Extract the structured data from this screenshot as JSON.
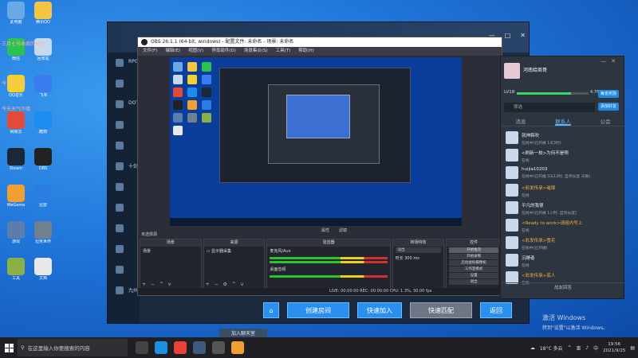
{
  "desktop": {
    "icons": [
      {
        "label": "此电脑",
        "color": "#6aa9e8"
      },
      {
        "label": "腾讯QQ",
        "color": "#f4c542"
      },
      {
        "label": "微信",
        "color": "#2bc24f"
      },
      {
        "label": "回收站",
        "color": "#c5d8ec"
      },
      {
        "label": "QQ音乐",
        "color": "#f5d130"
      },
      {
        "label": "飞书",
        "color": "#3b7bf0"
      },
      {
        "label": "网易云",
        "color": "#e44a3a"
      },
      {
        "label": "酷狗",
        "color": "#1c8cf0"
      },
      {
        "label": "Steam",
        "color": "#1b2838"
      },
      {
        "label": "OBS",
        "color": "#222"
      },
      {
        "label": "WeGame",
        "color": "#f0a030"
      },
      {
        "label": "迅雷",
        "color": "#2a7de1"
      },
      {
        "label": "游戏",
        "color": "#5a7dab"
      },
      {
        "label": "坦克世界",
        "color": "#708090"
      },
      {
        "label": "工具",
        "color": "#8ab04a"
      },
      {
        "label": "文档",
        "color": "#e8e8e8"
      }
    ],
    "red_text": [
      "三月七号本周的研究",
      "今日的心情",
      "今天天气不错"
    ]
  },
  "game": {
    "sidebar": [
      "RPG",
      "",
      "DOTA",
      "",
      "",
      "十剑",
      "",
      "",
      "",
      "",
      "",
      "九州"
    ],
    "buttons": {
      "create": "创建房间",
      "quick_join": "快速加入",
      "quick_match": "快速匹配",
      "back": "返回"
    },
    "join_channel": "加入聊天室"
  },
  "obs": {
    "title": "OBS 26.1.1 (64-bit, windows) - 配置文件: 未命名 - 场景: 未命名",
    "menu": [
      "文件(F)",
      "编辑(E)",
      "视图(V)",
      "停靠部件(D)",
      "场景集合(S)",
      "工具(T)",
      "帮助(H)"
    ],
    "scene_label": "未选择源",
    "status_tabs": [
      "属性",
      "滤镜"
    ],
    "docks": {
      "scenes": {
        "title": "场景",
        "item": "场景"
      },
      "sources": {
        "title": "来源",
        "item": "显示器采集"
      },
      "mixer": {
        "title": "混音器",
        "desktop_audio": "桌面音频",
        "mic_audio": "麦克风/Aux"
      },
      "transitions": {
        "title": "转场特效",
        "type": "淡出",
        "duration_label": "时长",
        "duration": "300 ms"
      },
      "controls": {
        "title": "控件",
        "items": [
          "开始推流",
          "开始录制",
          "启动虚拟摄像机",
          "工作室模式",
          "设置",
          "退出"
        ]
      }
    },
    "statusbar": "LIVE: 00:00:00   REC: 00:00:00   CPU: 1.3%, 30.00 fps"
  },
  "chat": {
    "name": "河南给商哥",
    "level": "LV18",
    "level_progress": 0.76,
    "level_pct": "4.76%",
    "btn1": "每省奖励",
    "btn2": "添加好友",
    "search_placeholder": "筛选",
    "tabs": [
      "消息",
      "联系人",
      "公会"
    ],
    "friends": [
      {
        "name": "就神韩吹",
        "status": "在线中(已开播 1天3时)",
        "orange": false
      },
      {
        "name": "<刷新一枚>为何不是啊",
        "status": "在线",
        "orange": false
      },
      {
        "name": "huijia10203",
        "status": "在线中(已开播 3天12时, 自然长度 天数)",
        "orange": false
      },
      {
        "name": "<彩发传承>璀璨",
        "status": "在线",
        "orange": true
      },
      {
        "name": "平凡的我很",
        "status": "在线中(已开播 1小时, 自然长度)",
        "orange": false
      },
      {
        "name": "<Ready to work>请组内号上",
        "status": "在线",
        "orange": true
      },
      {
        "name": "<彩发传承>雪花",
        "status": "在线中(已开播)",
        "orange": true
      },
      {
        "name": "沉睡者",
        "status": "在线",
        "orange": false
      },
      {
        "name": "<彩发传承>孤人",
        "status": "在线",
        "orange": true
      }
    ],
    "footer": "战友回答"
  },
  "watermark": {
    "title": "激活 Windows",
    "sub": "转到\"设置\"以激活 Windows。"
  },
  "taskbar": {
    "search_placeholder": "在这里输入你要搜索的内容",
    "apps": [
      {
        "name": "task-view",
        "color": "#444"
      },
      {
        "name": "edge",
        "color": "#1d8fe1"
      },
      {
        "name": "chrome",
        "color": "#e94235"
      },
      {
        "name": "steam",
        "color": "#3d5a80"
      },
      {
        "name": "obs",
        "color": "#555"
      },
      {
        "name": "game",
        "color": "#f0a030"
      }
    ],
    "temp": "18°C 多云",
    "lang": "中",
    "time": "19:56",
    "date": "2021/9/25"
  }
}
